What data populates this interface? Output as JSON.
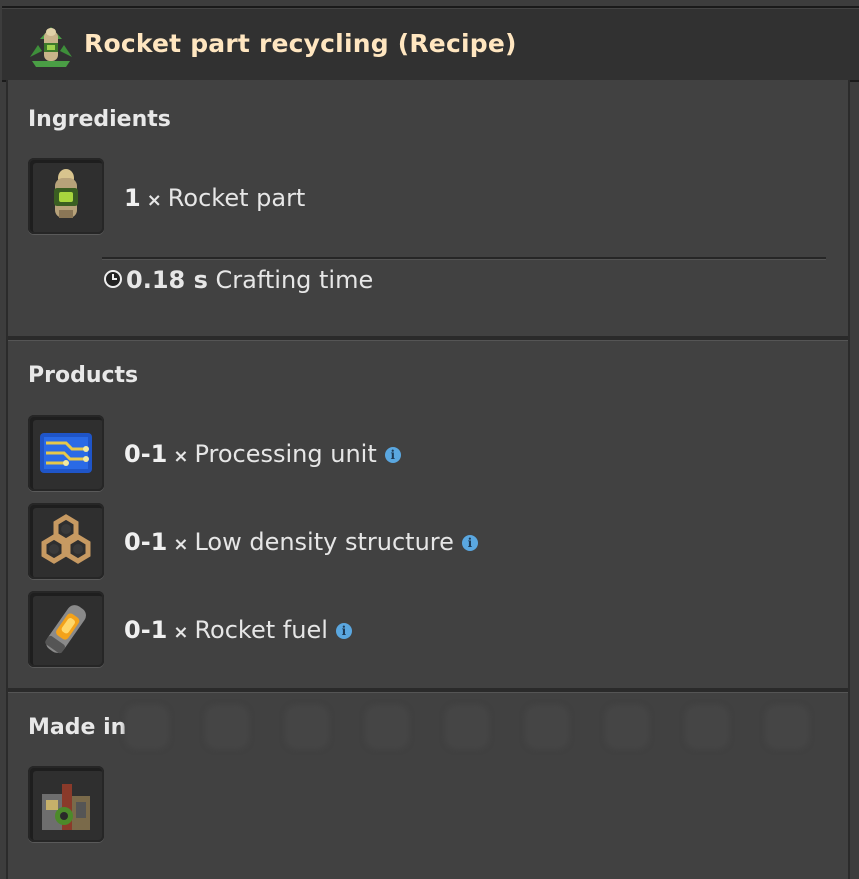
{
  "window": {
    "title": "Rocket part recycling (Recipe)",
    "title_icon": "recycling-rocket-part-icon"
  },
  "ingredients": {
    "heading": "Ingredients",
    "items": [
      {
        "amount": "1",
        "name": "Rocket part",
        "icon": "rocket-part-icon"
      }
    ],
    "crafting_time_value": "0.18 s",
    "crafting_time_label": "Crafting time"
  },
  "products": {
    "heading": "Products",
    "items": [
      {
        "amount": "0-1",
        "name": "Processing unit",
        "icon": "processing-unit-icon",
        "info": "i"
      },
      {
        "amount": "0-1",
        "name": "Low density structure",
        "icon": "low-density-structure-icon",
        "info": "i"
      },
      {
        "amount": "0-1",
        "name": "Rocket fuel",
        "icon": "rocket-fuel-icon",
        "info": "i"
      }
    ]
  },
  "made_in": {
    "heading": "Made in",
    "machines": [
      {
        "icon": "recycler-icon"
      }
    ]
  },
  "symbols": {
    "times": "×"
  },
  "colors": {
    "title": "#ffe6c0",
    "panel": "#414141",
    "info": "#5aa7e0"
  }
}
